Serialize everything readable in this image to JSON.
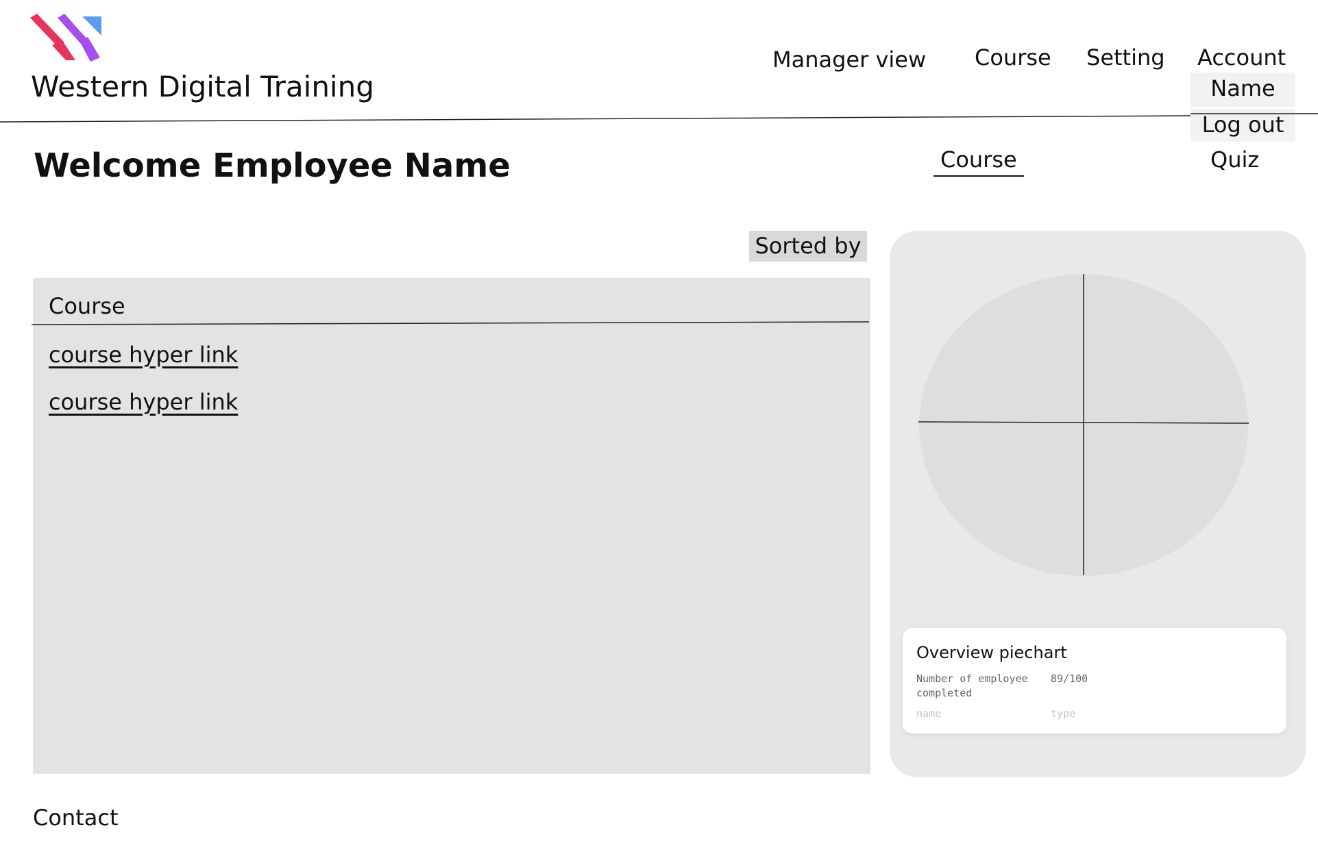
{
  "header": {
    "brand": "Western Digital Training",
    "logo": {
      "name": "western-digital-training-logo",
      "colors": [
        "#e8335b",
        "#a64ef0",
        "#5b9bf2"
      ]
    },
    "nav": [
      {
        "label": "Manager view"
      },
      {
        "label": "Course"
      },
      {
        "label": "Setting"
      },
      {
        "label": "Account"
      }
    ],
    "account_menu": {
      "items": [
        {
          "label": "Name"
        },
        {
          "label": "Log out"
        }
      ]
    }
  },
  "welcome": "Welcome Employee Name",
  "tabs": [
    {
      "label": "Course",
      "active": true
    },
    {
      "label": "Quiz",
      "active": false
    }
  ],
  "course_list": {
    "sort_label": "Sorted by",
    "header": "Course",
    "items": [
      {
        "label": "course hyper link"
      },
      {
        "label": "course hyper link"
      }
    ]
  },
  "chart_card": {
    "title": "Overview piechart",
    "rows": [
      {
        "label_line1": "Number of employee",
        "label_line2": "completed",
        "value": "89/100"
      },
      {
        "label_line1": "name",
        "label_line2": "",
        "value": "type"
      }
    ]
  },
  "chart_data": {
    "type": "pie",
    "slices": 4,
    "colors": {
      "fill": "#dedede",
      "divider": "#222222"
    }
  },
  "footer": {
    "contact": "Contact"
  }
}
